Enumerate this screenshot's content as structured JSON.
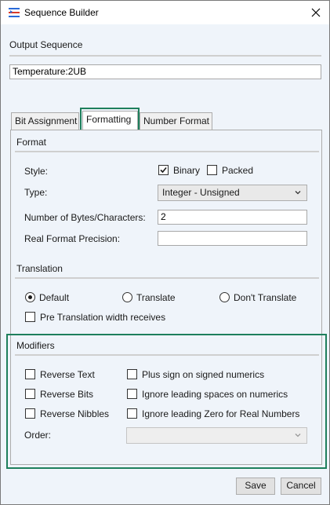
{
  "window": {
    "title": "Sequence Builder",
    "app_icon": "sequence-builder-icon",
    "close_icon": "close-icon"
  },
  "output": {
    "label": "Output Sequence",
    "value": "Temperature:2UB"
  },
  "tabs": [
    {
      "label": "Bit Assignment"
    },
    {
      "label": "Formatting"
    },
    {
      "label": "Number Format"
    }
  ],
  "format": {
    "title": "Format",
    "style_label": "Style:",
    "binary_label": "Binary",
    "binary_checked": true,
    "packed_label": "Packed",
    "packed_checked": false,
    "type_label": "Type:",
    "type_value": "Integer - Unsigned",
    "bytes_label": "Number of Bytes/Characters:",
    "bytes_value": "2",
    "precision_label": "Real Format Precision:",
    "precision_value": ""
  },
  "translation": {
    "title": "Translation",
    "options": [
      "Default",
      "Translate",
      "Don't Translate"
    ],
    "selected": "Default",
    "pre_translation_label": "Pre Translation width receives",
    "pre_translation_checked": false
  },
  "modifiers": {
    "title": "Modifiers",
    "reverse_text": "Reverse Text",
    "reverse_bits": "Reverse Bits",
    "reverse_nibbles": "Reverse Nibbles",
    "plus_sign": "Plus sign on signed numerics",
    "ignore_spaces": "Ignore leading spaces on numerics",
    "ignore_zero": "Ignore leading Zero for Real Numbers",
    "order_label": "Order:",
    "order_value": ""
  },
  "buttons": {
    "save": "Save",
    "cancel": "Cancel"
  },
  "colors": {
    "highlight": "#1e7f5c",
    "panel_bg": "#eff4fa",
    "title_bg": "#ffffff"
  }
}
